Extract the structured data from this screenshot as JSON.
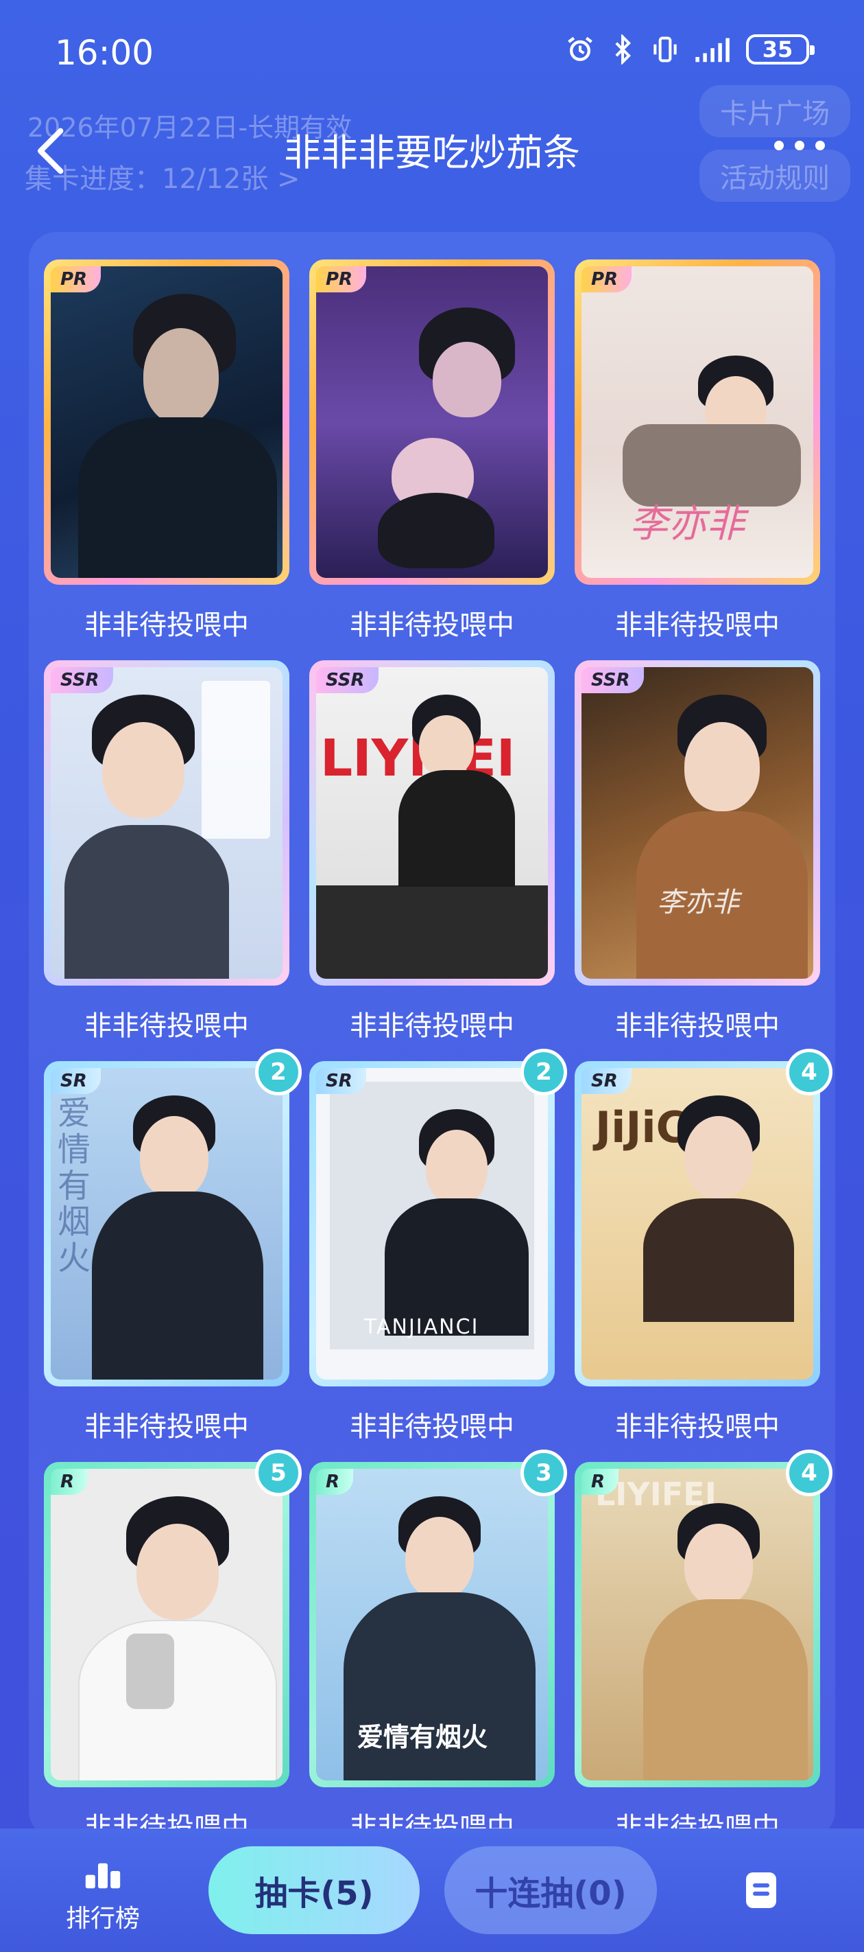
{
  "status": {
    "time": "16:00",
    "battery": "35"
  },
  "header": {
    "title": "非非非要吃炒茄条",
    "bg_date": "2026年07月22日-长期有效",
    "bg_progress": "集卡进度：12/12张 >",
    "bg_square": "卡片广场",
    "bg_rules": "活动规则"
  },
  "cards": [
    {
      "rarity": "PR",
      "label": "非非待投喂中",
      "count": ""
    },
    {
      "rarity": "PR",
      "label": "非非待投喂中",
      "count": ""
    },
    {
      "rarity": "PR",
      "label": "非非待投喂中",
      "count": ""
    },
    {
      "rarity": "SSR",
      "label": "非非待投喂中",
      "count": ""
    },
    {
      "rarity": "SSR",
      "label": "非非待投喂中",
      "count": ""
    },
    {
      "rarity": "SSR",
      "label": "非非待投喂中",
      "count": ""
    },
    {
      "rarity": "SR",
      "label": "非非待投喂中",
      "count": "2"
    },
    {
      "rarity": "SR",
      "label": "非非待投喂中",
      "count": "2"
    },
    {
      "rarity": "SR",
      "label": "非非待投喂中",
      "count": "4"
    },
    {
      "rarity": "R",
      "label": "非非待投喂中",
      "count": "5"
    },
    {
      "rarity": "R",
      "label": "非非待投喂中",
      "count": "3"
    },
    {
      "rarity": "R",
      "label": "非非待投喂中",
      "count": "4"
    }
  ],
  "card_art_text": {
    "c3": "李亦非",
    "c5": "LIYIFEI",
    "c6": "李亦非",
    "c7": "爱情有烟火",
    "c8": "TANJIANCI",
    "c9": "JiJiCi",
    "c11": "爱情有烟火",
    "c12": "LIYIFEI"
  },
  "bottom": {
    "rank_label": "排行榜",
    "draw_label": "抽卡(5)",
    "ten_label": "十连抽(0)"
  },
  "colors": {
    "accent": "#3ec9d6",
    "background": "#3f5ce4"
  }
}
